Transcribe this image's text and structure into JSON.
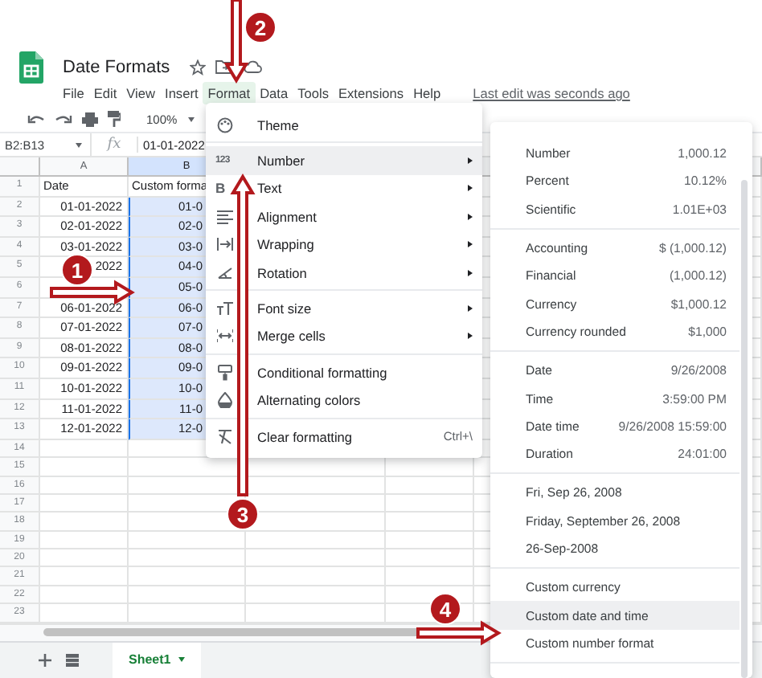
{
  "header": {
    "title": "Date Formats",
    "last_edit": "Last edit was seconds ago",
    "menu": [
      {
        "label": "File",
        "selected": false
      },
      {
        "label": "Edit",
        "selected": false
      },
      {
        "label": "View",
        "selected": false
      },
      {
        "label": "Insert",
        "selected": false
      },
      {
        "label": "Format",
        "selected": true
      },
      {
        "label": "Data",
        "selected": false
      },
      {
        "label": "Tools",
        "selected": false
      },
      {
        "label": "Extensions",
        "selected": false
      },
      {
        "label": "Help",
        "selected": false
      }
    ]
  },
  "toolbar": {
    "zoom": "100%"
  },
  "formula_bar": {
    "range": "B2:B13",
    "fx": "fx",
    "value": "01-01-2022"
  },
  "sheet": {
    "columns": [
      "A",
      "B"
    ],
    "rows": [
      {
        "number": "1",
        "column_a": "Date",
        "column_b": "Custom forma",
        "selected": false
      },
      {
        "number": "2",
        "column_a": "01-01-2022",
        "column_b": "01-0",
        "selected": true
      },
      {
        "number": "3",
        "column_a": "02-01-2022",
        "column_b": "02-0",
        "selected": true
      },
      {
        "number": "4",
        "column_a": "03-01-2022",
        "column_b": "03-0",
        "selected": true
      },
      {
        "number": "5",
        "column_a": "2022",
        "column_b": "04-0",
        "selected": true
      },
      {
        "number": "6",
        "column_b": "05-0",
        "selected": true
      },
      {
        "number": "7",
        "column_a": "06-01-2022",
        "column_b": "06-0",
        "selected": true
      },
      {
        "number": "8",
        "column_a": "07-01-2022",
        "column_b": "07-0",
        "selected": true
      },
      {
        "number": "9",
        "column_a": "08-01-2022",
        "column_b": "08-0",
        "selected": true
      },
      {
        "number": "10",
        "column_a": "09-01-2022",
        "column_b": "09-0",
        "selected": true
      },
      {
        "number": "11",
        "column_a": "10-01-2022",
        "column_b": "10-0",
        "selected": true
      },
      {
        "number": "12",
        "column_a": "11-01-2022",
        "column_b": "11-0",
        "selected": true
      },
      {
        "number": "13",
        "column_a": "12-01-2022",
        "column_b": "12-0",
        "selected": true
      }
    ],
    "empty_rows": [
      "14",
      "15",
      "16",
      "17",
      "18",
      "19",
      "20",
      "21",
      "22",
      "23"
    ]
  },
  "sheet_tabs": [
    {
      "label": "Sheet1",
      "selected": true
    }
  ],
  "format_menu": {
    "sections": [
      [
        {
          "label": "Theme",
          "submenu": false,
          "selected": false
        }
      ],
      [
        {
          "label": "Number",
          "glyph": "123",
          "submenu": true,
          "selected": true
        },
        {
          "label": "Text",
          "glyph": "B",
          "submenu": true,
          "selected": false
        },
        {
          "label": "Alignment",
          "submenu": true,
          "selected": false
        },
        {
          "label": "Wrapping",
          "submenu": true,
          "selected": false
        },
        {
          "label": "Rotation",
          "submenu": true,
          "selected": false
        }
      ],
      [
        {
          "label": "Font size",
          "submenu": true,
          "selected": false
        },
        {
          "label": "Merge cells",
          "submenu": true,
          "selected": false
        }
      ],
      [
        {
          "label": "Conditional formatting",
          "submenu": false,
          "selected": false
        },
        {
          "label": "Alternating colors",
          "submenu": false,
          "selected": false
        }
      ],
      [
        {
          "label": "Clear formatting",
          "shortcut": "Ctrl+\\",
          "submenu": false,
          "selected": false
        }
      ]
    ]
  },
  "number_submenu": {
    "sections": [
      [
        {
          "label": "Number",
          "example": "1,000.12",
          "selected": false
        },
        {
          "label": "Percent",
          "example": "10.12%",
          "selected": false
        },
        {
          "label": "Scientific",
          "example": "1.01E+03",
          "selected": false
        }
      ],
      [
        {
          "label": "Accounting",
          "example": "$ (1,000.12)",
          "selected": false
        },
        {
          "label": "Financial",
          "example": "(1,000.12)",
          "selected": false
        },
        {
          "label": "Currency",
          "example": "$1,000.12",
          "selected": false
        },
        {
          "label": "Currency rounded",
          "example": "$1,000",
          "selected": false
        }
      ],
      [
        {
          "label": "Date",
          "example": "9/26/2008",
          "selected": false
        },
        {
          "label": "Time",
          "example": "3:59:00 PM",
          "selected": false
        },
        {
          "label": "Date time",
          "example": "9/26/2008 15:59:00",
          "selected": false
        },
        {
          "label": "Duration",
          "example": "24:01:00",
          "selected": false
        }
      ],
      [
        {
          "label": "Fri, Sep 26, 2008",
          "selected": false
        },
        {
          "label": "Friday, September 26, 2008",
          "selected": false
        },
        {
          "label": "26-Sep-2008",
          "selected": false
        }
      ],
      [
        {
          "label": "Custom currency",
          "selected": false
        },
        {
          "label": "Custom date and time",
          "selected": true
        },
        {
          "label": "Custom number format",
          "selected": false
        }
      ]
    ]
  },
  "callouts": [
    {
      "label": "1"
    },
    {
      "label": "2"
    },
    {
      "label": "3"
    },
    {
      "label": "4"
    }
  ]
}
